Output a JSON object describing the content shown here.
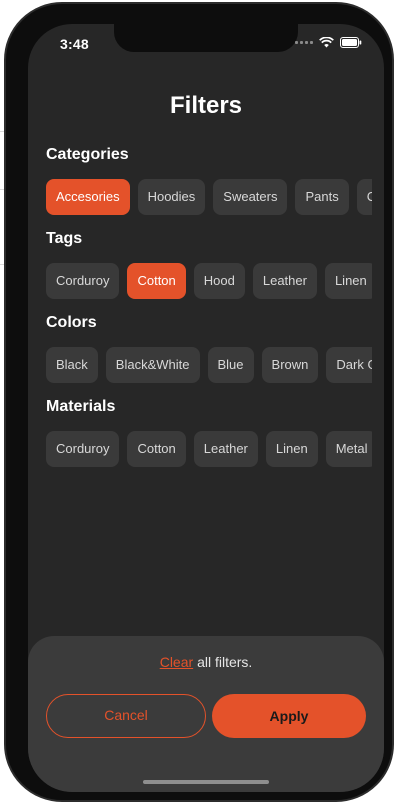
{
  "status_bar": {
    "time": "3:48"
  },
  "title": "Filters",
  "sections": [
    {
      "label": "Categories",
      "chips": [
        {
          "label": "Accesories",
          "selected": true
        },
        {
          "label": "Hoodies",
          "selected": false
        },
        {
          "label": "Sweaters",
          "selected": false
        },
        {
          "label": "Pants",
          "selected": false
        },
        {
          "label": "C",
          "selected": false
        }
      ]
    },
    {
      "label": "Tags",
      "chips": [
        {
          "label": "Corduroy",
          "selected": false
        },
        {
          "label": "Cotton",
          "selected": true
        },
        {
          "label": "Hood",
          "selected": false
        },
        {
          "label": "Leather",
          "selected": false
        },
        {
          "label": "Linen",
          "selected": false
        }
      ]
    },
    {
      "label": "Colors",
      "chips": [
        {
          "label": "Black",
          "selected": false
        },
        {
          "label": "Black&White",
          "selected": false
        },
        {
          "label": "Blue",
          "selected": false
        },
        {
          "label": "Brown",
          "selected": false
        },
        {
          "label": "Dark G",
          "selected": false
        }
      ]
    },
    {
      "label": "Materials",
      "chips": [
        {
          "label": "Corduroy",
          "selected": false
        },
        {
          "label": "Cotton",
          "selected": false
        },
        {
          "label": "Leather",
          "selected": false
        },
        {
          "label": "Linen",
          "selected": false
        },
        {
          "label": "Metal",
          "selected": false
        }
      ]
    }
  ],
  "bottom_sheet": {
    "clear_link": "Clear",
    "clear_suffix": "all filters.",
    "cancel_label": "Cancel",
    "apply_label": "Apply"
  },
  "colors": {
    "accent": "#e4522a",
    "background": "#272727",
    "chip": "#3a3a3a",
    "sheet": "#3b3b3b"
  }
}
